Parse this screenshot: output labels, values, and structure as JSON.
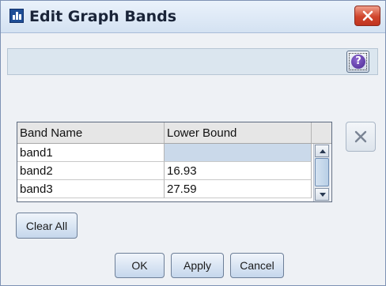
{
  "window": {
    "title": "Edit Graph Bands",
    "icon": "bar-chart-icon",
    "close_icon": "close-icon"
  },
  "toolbar": {
    "help_label": "?",
    "help_icon": "help-icon"
  },
  "table": {
    "columns": [
      "Band Name",
      "Lower Bound"
    ],
    "rows": [
      {
        "name": "band1",
        "lower_bound": ""
      },
      {
        "name": "band2",
        "lower_bound": "16.93"
      },
      {
        "name": "band3",
        "lower_bound": "27.59"
      }
    ]
  },
  "side": {
    "delete_icon": "delete-x-icon"
  },
  "buttons": {
    "clear_all": "Clear All",
    "ok": "OK",
    "apply": "Apply",
    "cancel": "Cancel"
  },
  "colors": {
    "close_button": "#d0452c",
    "selected_cell": "#cad9ea",
    "help_button": "#4a2a92",
    "window_bg": "#eef1f5"
  }
}
